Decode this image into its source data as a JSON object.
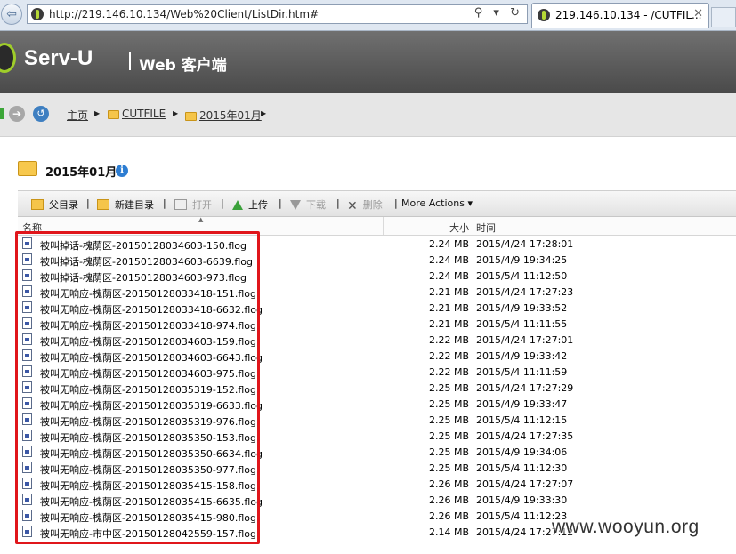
{
  "browser": {
    "url": "http://219.146.10.134/Web%20Client/ListDir.htm#",
    "addr_buttons": "⚲ ▾ ↻",
    "tab_title": "219.146.10.134 - /CUTFIL...",
    "tab_close": "✕",
    "back": "⇦"
  },
  "header": {
    "logo": "Serv-U",
    "title": "Web 客户端"
  },
  "nav": {
    "forward": "➔",
    "history": "↺"
  },
  "breadcrumb": {
    "home": "主页",
    "items": [
      "CUTFILE",
      "2015年01月"
    ],
    "arrow": "▶"
  },
  "folder": {
    "name": "2015年01月",
    "info": "i"
  },
  "toolbar": {
    "parent": "父目录",
    "new_dir": "新建目录",
    "open": "打开",
    "upload": "上传",
    "download": "下载",
    "delete": "删除",
    "more": "More Actions",
    "more_caret": "▾",
    "sep": "|"
  },
  "table": {
    "headers": {
      "name": "名称",
      "size": "大小",
      "time": "时间"
    },
    "sort_caret": "▲",
    "rows": [
      {
        "name": "被叫掉话-槐荫区-20150128034603-150.flog",
        "size": "2.24 MB",
        "time": "2015/4/24 17:28:01"
      },
      {
        "name": "被叫掉话-槐荫区-20150128034603-6639.flog",
        "size": "2.24 MB",
        "time": "2015/4/9 19:34:25"
      },
      {
        "name": "被叫掉话-槐荫区-20150128034603-973.flog",
        "size": "2.24 MB",
        "time": "2015/5/4 11:12:50"
      },
      {
        "name": "被叫无响应-槐荫区-20150128033418-151.flog",
        "size": "2.21 MB",
        "time": "2015/4/24 17:27:23"
      },
      {
        "name": "被叫无响应-槐荫区-20150128033418-6632.flog",
        "size": "2.21 MB",
        "time": "2015/4/9 19:33:52"
      },
      {
        "name": "被叫无响应-槐荫区-20150128033418-974.flog",
        "size": "2.21 MB",
        "time": "2015/5/4 11:11:55"
      },
      {
        "name": "被叫无响应-槐荫区-20150128034603-159.flog",
        "size": "2.22 MB",
        "time": "2015/4/24 17:27:01"
      },
      {
        "name": "被叫无响应-槐荫区-20150128034603-6643.flog",
        "size": "2.22 MB",
        "time": "2015/4/9 19:33:42"
      },
      {
        "name": "被叫无响应-槐荫区-20150128034603-975.flog",
        "size": "2.22 MB",
        "time": "2015/5/4 11:11:59"
      },
      {
        "name": "被叫无响应-槐荫区-20150128035319-152.flog",
        "size": "2.25 MB",
        "time": "2015/4/24 17:27:29"
      },
      {
        "name": "被叫无响应-槐荫区-20150128035319-6633.flog",
        "size": "2.25 MB",
        "time": "2015/4/9 19:33:47"
      },
      {
        "name": "被叫无响应-槐荫区-20150128035319-976.flog",
        "size": "2.25 MB",
        "time": "2015/5/4 11:12:15"
      },
      {
        "name": "被叫无响应-槐荫区-20150128035350-153.flog",
        "size": "2.25 MB",
        "time": "2015/4/24 17:27:35"
      },
      {
        "name": "被叫无响应-槐荫区-20150128035350-6634.flog",
        "size": "2.25 MB",
        "time": "2015/4/9 19:34:06"
      },
      {
        "name": "被叫无响应-槐荫区-20150128035350-977.flog",
        "size": "2.25 MB",
        "time": "2015/5/4 11:12:30"
      },
      {
        "name": "被叫无响应-槐荫区-20150128035415-158.flog",
        "size": "2.26 MB",
        "time": "2015/4/24 17:27:07"
      },
      {
        "name": "被叫无响应-槐荫区-20150128035415-6635.flog",
        "size": "2.26 MB",
        "time": "2015/4/9 19:33:30"
      },
      {
        "name": "被叫无响应-槐荫区-20150128035415-980.flog",
        "size": "2.26 MB",
        "time": "2015/5/4 11:12:23"
      },
      {
        "name": "被叫无响应-市中区-20150128042559-157.flog",
        "size": "2.14 MB",
        "time": "2015/4/24 17:27:12"
      }
    ]
  },
  "watermark": "www.wooyun.org",
  "colors": {
    "highlight": "#e0161b",
    "brand_green": "#9fcd2a"
  }
}
